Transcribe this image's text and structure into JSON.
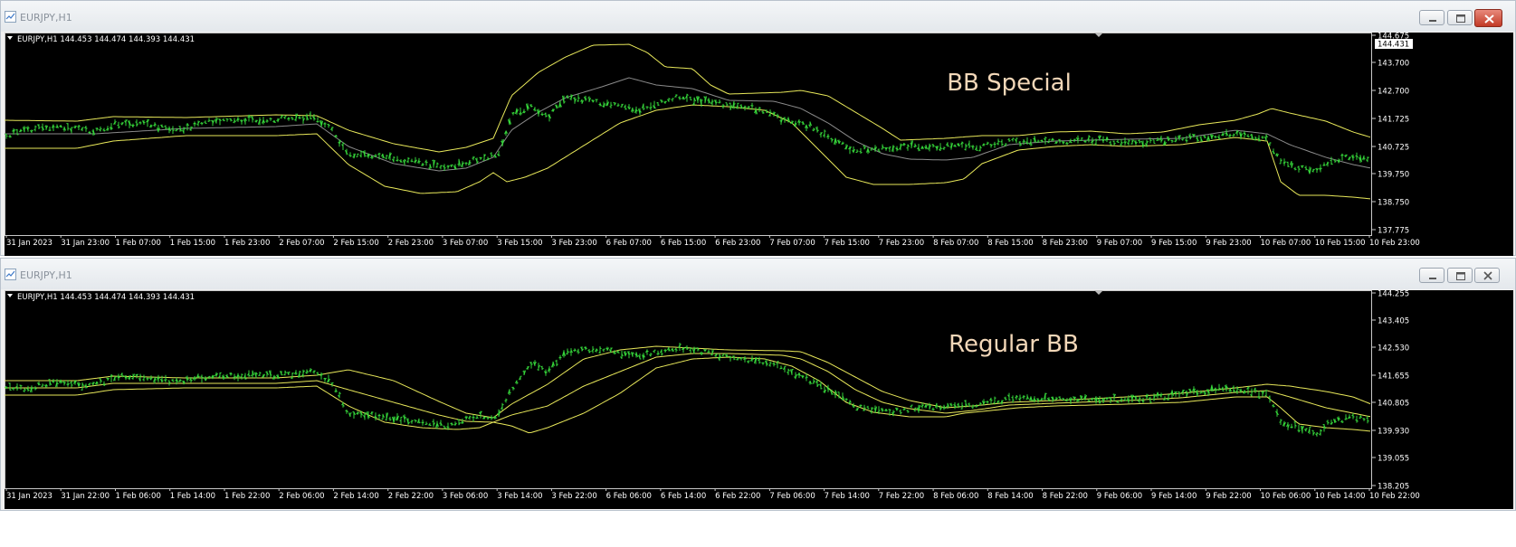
{
  "windows": [
    {
      "title": "EURJPY,H1",
      "info": "EURJPY,H1  144.453 144.474 144.393 144.431",
      "label": "BB Special",
      "price_ticks": [
        "144.675",
        "143.700",
        "142.700",
        "141.725",
        "140.725",
        "139.750",
        "138.750",
        "137.775"
      ],
      "current_price": "144.431",
      "time_ticks": [
        "31 Jan 2023",
        "31 Jan 23:00",
        "1 Feb 07:00",
        "1 Feb 15:00",
        "1 Feb 23:00",
        "2 Feb 07:00",
        "2 Feb 15:00",
        "2 Feb 23:00",
        "3 Feb 07:00",
        "3 Feb 15:00",
        "3 Feb 23:00",
        "6 Feb 07:00",
        "6 Feb 15:00",
        "6 Feb 23:00",
        "7 Feb 07:00",
        "7 Feb 15:00",
        "7 Feb 23:00",
        "8 Feb 07:00",
        "8 Feb 15:00",
        "8 Feb 23:00",
        "9 Feb 07:00",
        "9 Feb 15:00",
        "9 Feb 23:00",
        "10 Feb 07:00",
        "10 Feb 15:00",
        "10 Feb 23:00"
      ]
    },
    {
      "title": "EURJPY,H1",
      "info": "EURJPY,H1  144.453 144.474 144.393 144.431",
      "label": "Regular BB",
      "price_ticks": [
        "144.255",
        "143.405",
        "142.530",
        "141.655",
        "140.805",
        "139.930",
        "139.055",
        "138.205"
      ],
      "current_price": "",
      "time_ticks": [
        "31 Jan 2023",
        "31 Jan 22:00",
        "1 Feb 06:00",
        "1 Feb 14:00",
        "1 Feb 22:00",
        "2 Feb 06:00",
        "2 Feb 14:00",
        "2 Feb 22:00",
        "3 Feb 06:00",
        "3 Feb 14:00",
        "3 Feb 22:00",
        "6 Feb 06:00",
        "6 Feb 14:00",
        "6 Feb 22:00",
        "7 Feb 06:00",
        "7 Feb 14:00",
        "7 Feb 22:00",
        "8 Feb 06:00",
        "8 Feb 14:00",
        "8 Feb 22:00",
        "9 Feb 06:00",
        "9 Feb 14:00",
        "9 Feb 22:00",
        "10 Feb 06:00",
        "10 Feb 14:00",
        "10 Feb 22:00"
      ]
    }
  ],
  "colors": {
    "background": "#000000",
    "bars": "#35d53a",
    "bands": "#e8e85a",
    "middle_band_special": "#8a8a8a",
    "label": "#f2d7b8",
    "axis_text": "#ffffff",
    "close_button_active": "#c8402c"
  },
  "icons": [
    "chart-window-icon",
    "minimize-icon",
    "restore-icon",
    "close-icon",
    "dropdown-triangle-icon"
  ]
}
